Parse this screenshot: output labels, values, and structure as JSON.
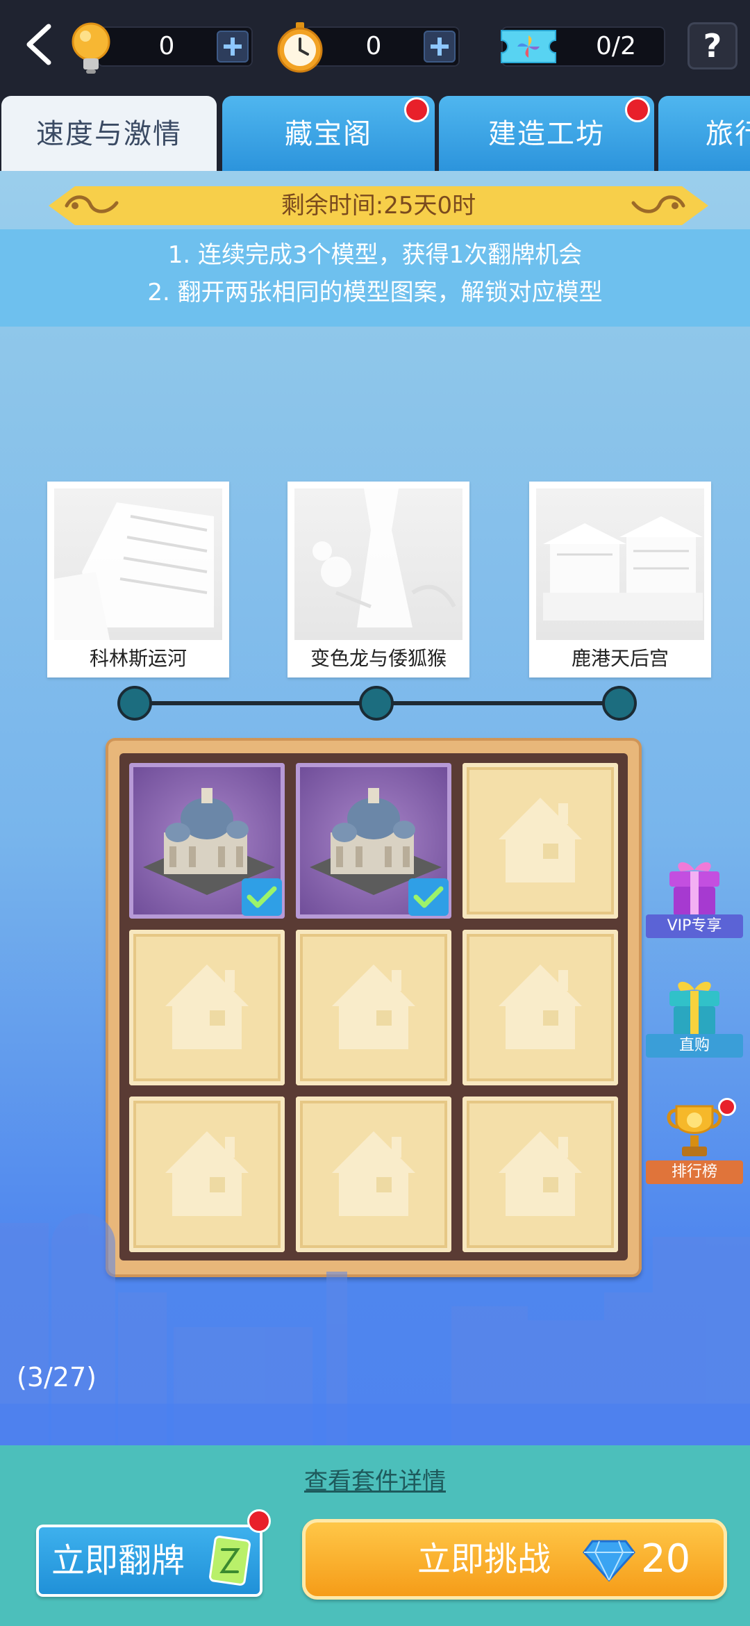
{
  "header": {
    "bulb_count": "0",
    "timer_count": "0",
    "ticket_count": "0/2",
    "help_label": "?"
  },
  "tabs": [
    {
      "label": "速度与激情",
      "active": true,
      "badge": false
    },
    {
      "label": "藏宝阁",
      "active": false,
      "badge": true
    },
    {
      "label": "建造工坊",
      "active": false,
      "badge": true
    },
    {
      "label": "旅行",
      "active": false,
      "badge": false
    }
  ],
  "event": {
    "time_left": "剩余时间:25天0时",
    "rules": [
      "1. 连续完成3个模型，获得1次翻牌机会",
      "2. 翻开两张相同的模型图案，解锁对应模型"
    ]
  },
  "models": [
    {
      "name": "科林斯运河"
    },
    {
      "name": "变色龙与倭狐猴"
    },
    {
      "name": "鹿港天后宫"
    }
  ],
  "board": {
    "cells": [
      "open",
      "open",
      "locked",
      "locked",
      "locked",
      "locked",
      "locked",
      "locked",
      "locked"
    ]
  },
  "side_buttons": {
    "vip": "VIP专享",
    "buy": "直购",
    "rank": "排行榜"
  },
  "progress": "(3/27)",
  "bottom": {
    "details_link": "查看套件详情",
    "flip_label": "立即翻牌",
    "challenge_label": "立即挑战",
    "challenge_cost": "20"
  },
  "colors": {
    "accent_orange": "#f59a16",
    "accent_blue": "#2c94dc",
    "badge_red": "#e8202a"
  }
}
